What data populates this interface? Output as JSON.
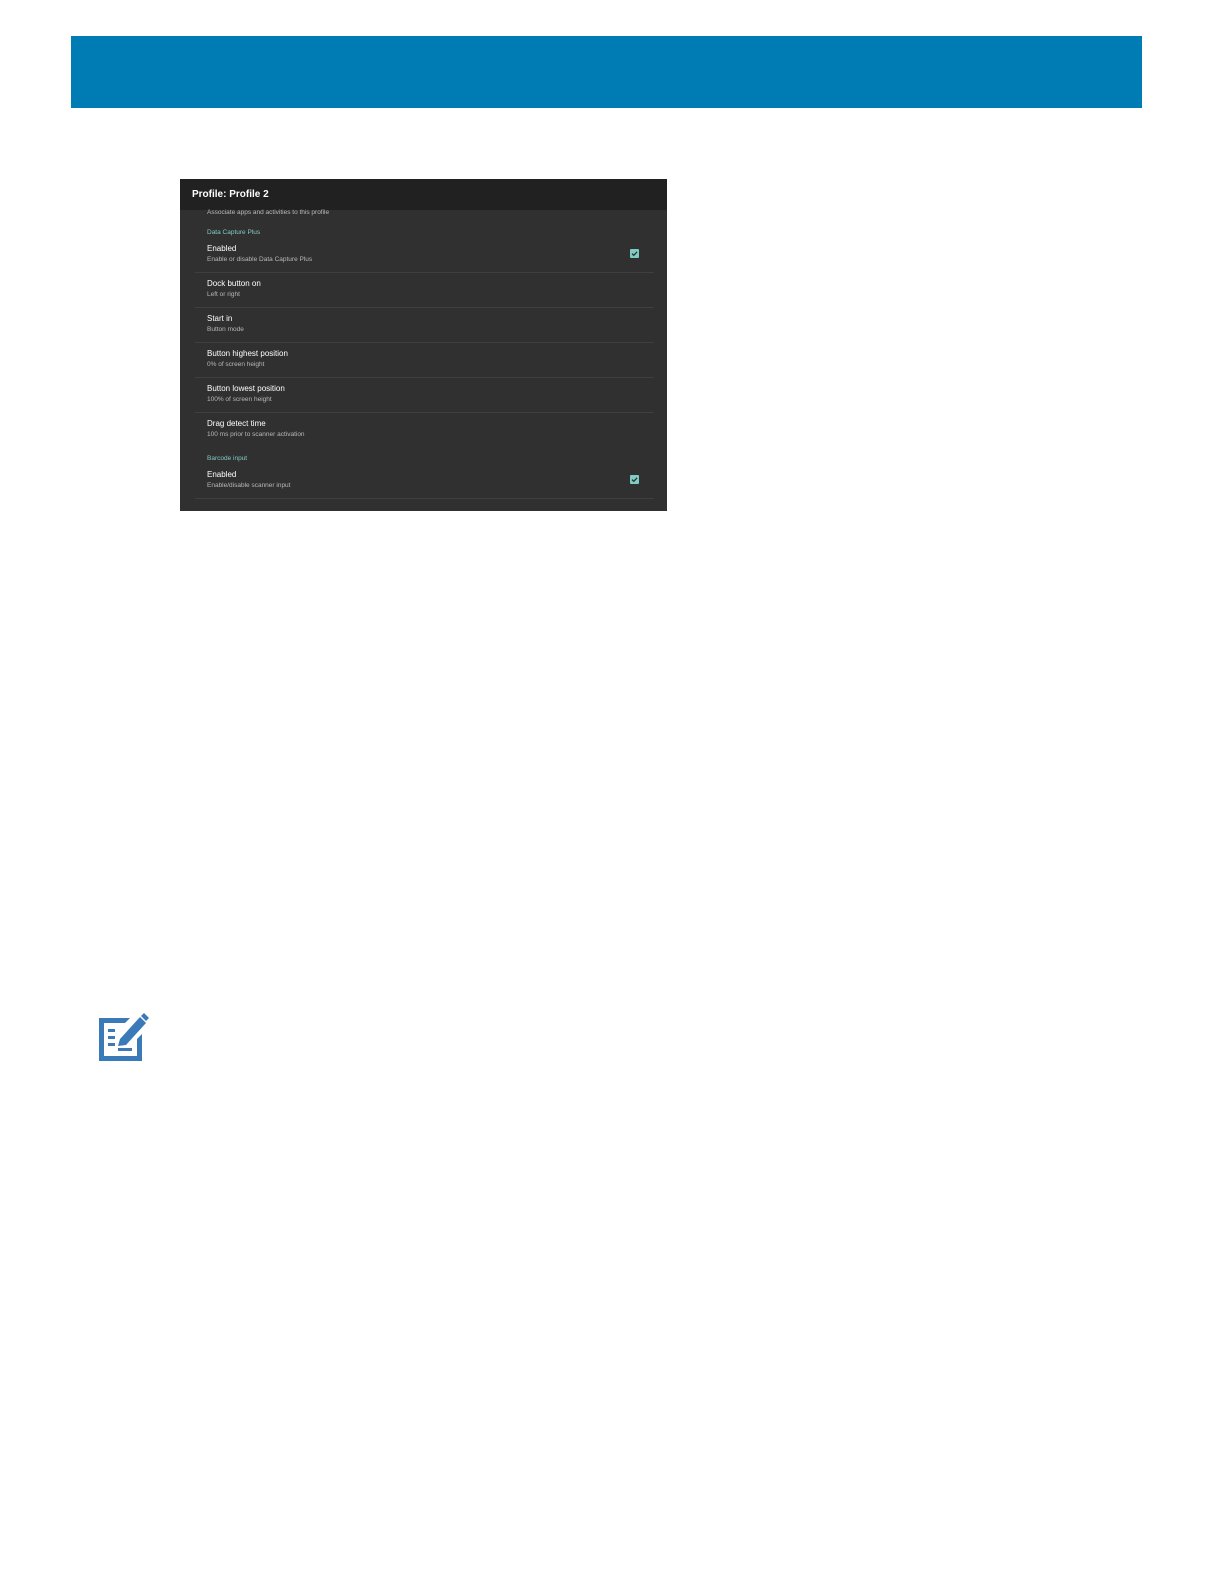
{
  "header": {
    "band_color": "#007cb5"
  },
  "screenshot": {
    "app_bar_title": "Profile: Profile 2",
    "partial_summary": "Associate apps and activities to this profile",
    "accent_color": "#80cbc4",
    "sections": [
      {
        "category": "Data Capture Plus",
        "prefs": [
          {
            "title": "Enabled",
            "summary": "Enable or disable Data Capture Plus",
            "checked": true
          },
          {
            "title": "Dock button on",
            "summary": "Left or right"
          },
          {
            "title": "Start in",
            "summary": "Button mode"
          },
          {
            "title": "Button highest position",
            "summary": "0% of screen height"
          },
          {
            "title": "Button lowest position",
            "summary": "100% of screen height"
          },
          {
            "title": "Drag detect time",
            "summary": "100 ms prior to scanner activation"
          }
        ]
      },
      {
        "category": "Barcode input",
        "prefs": [
          {
            "title": "Enabled",
            "summary": "Enable/disable scanner input",
            "checked": true
          }
        ]
      }
    ]
  },
  "note": {
    "icon": "note-edit-icon",
    "icon_color": "#3a7ab8"
  }
}
